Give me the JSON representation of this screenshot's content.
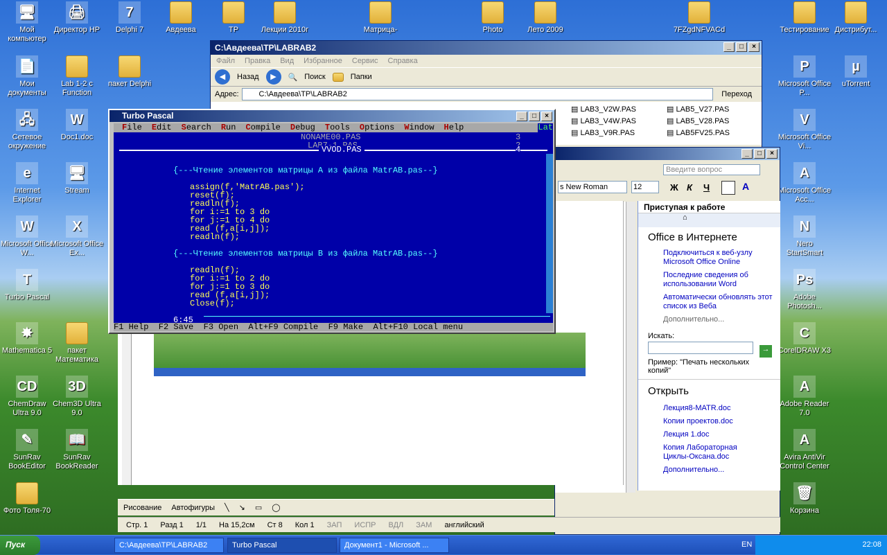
{
  "desktop_icons": [
    {
      "label": "Мой компьютер",
      "glyph": "🖥"
    },
    {
      "label": "Директор HP",
      "glyph": "🖨"
    },
    {
      "label": "Delphi 7",
      "glyph": "7"
    },
    {
      "label": "Авдеева",
      "glyph": ""
    },
    {
      "label": "TP",
      "glyph": ""
    },
    {
      "label": "Лекции 2010г",
      "glyph": ""
    },
    {
      "label": "Матрица-",
      "glyph": ""
    },
    {
      "label": "Photo",
      "glyph": ""
    },
    {
      "label": "Лето 2009",
      "glyph": ""
    },
    {
      "label": "7FZgdNFVACd",
      "glyph": ""
    },
    {
      "label": "Тестирование",
      "glyph": ""
    },
    {
      "label": "Дистрибут...",
      "glyph": ""
    },
    {
      "label": "Мои документы",
      "glyph": "📄"
    },
    {
      "label": "Lab 1-2 с Function",
      "glyph": ""
    },
    {
      "label": "пакет Delphi",
      "glyph": ""
    },
    {
      "label": "Microsoft Office P...",
      "glyph": "P"
    },
    {
      "label": "uTorrent",
      "glyph": "µ"
    },
    {
      "label": "Сетевое окружение",
      "glyph": "🖧"
    },
    {
      "label": "Doc1.doc",
      "glyph": "W"
    },
    {
      "label": "Microsoft Office Vi...",
      "glyph": "V"
    },
    {
      "label": "Internet Explorer",
      "glyph": "e"
    },
    {
      "label": "Stream",
      "glyph": "🖥"
    },
    {
      "label": "Microsoft Office Acc...",
      "glyph": "A"
    },
    {
      "label": "Microsoft Office W...",
      "glyph": "W"
    },
    {
      "label": "Microsoft Office Ex...",
      "glyph": "X"
    },
    {
      "label": "Nero StartSmart",
      "glyph": "N"
    },
    {
      "label": "Turbo Pascal",
      "glyph": "T"
    },
    {
      "label": "Adobe Photosh...",
      "glyph": "Ps"
    },
    {
      "label": "Mathematica 5",
      "glyph": "✸"
    },
    {
      "label": "пакет Математика",
      "glyph": ""
    },
    {
      "label": "CorelDRAW X3",
      "glyph": "C"
    },
    {
      "label": "ChemDraw Ultra 9.0",
      "glyph": "CD"
    },
    {
      "label": "Chem3D Ultra 9.0",
      "glyph": "3D"
    },
    {
      "label": "Adobe Reader 7.0",
      "glyph": "A"
    },
    {
      "label": "SunRav BookEditor",
      "glyph": "✎"
    },
    {
      "label": "SunRav BookReader",
      "glyph": "📖"
    },
    {
      "label": "Avira AntiVir Control Center",
      "glyph": "A"
    },
    {
      "label": "Фото Толя-70",
      "glyph": ""
    },
    {
      "label": "Корзина",
      "glyph": "🗑"
    }
  ],
  "explorer": {
    "title": "C:\\Авдеева\\TP\\LABRAB2",
    "menu": [
      "Файл",
      "Правка",
      "Вид",
      "Избранное",
      "Сервис",
      "Справка"
    ],
    "toolbar": {
      "back": "Назад",
      "search": "Поиск",
      "folders": "Папки"
    },
    "address_label": "Адрес:",
    "address_value": "C:\\Авдеева\\TP\\LABRAB2",
    "go": "Переход",
    "files": [
      "LAB3_V2W.PAS",
      "LAB5_V27.PAS",
      "LAB3_V4W.PAS",
      "LAB5_V28.PAS",
      "LAB3_V9R.PAS",
      "LAB5FV25.PAS"
    ]
  },
  "turbo": {
    "title": "Turbo Pascal",
    "menu": [
      "File",
      "Edit",
      "Search",
      "Run",
      "Compile",
      "Debug",
      "Tools",
      "Options",
      "Window",
      "Help"
    ],
    "lat": "Lat",
    "win3": "NONAME00.PAS",
    "win3n": "3",
    "win2": "LAB7-1.PAS",
    "win2n": "2",
    "win1": "VVOD.PAS",
    "win1n": "4",
    "comment1": "{---Чтение элементов матрицы A из файла MatrAB.pas--}",
    "comment2": "{---Чтение элементов матрицы B из файла MatrAB.pas--}",
    "code1": [
      "assign(f,'MatrAB.pas');",
      "reset(f);",
      "readln(f);",
      "for i:=1 to 3 do",
      "for j:=1 to 4 do",
      "read (f,a[i,j]);",
      "readln(f);"
    ],
    "code2": [
      "readln(f);",
      "for i:=1 to 2 do",
      "for j:=1 to 3 do",
      "read (f,a[i,j]);",
      "Close(f);"
    ],
    "cursor": "6:45",
    "status": "F1 Help  F2 Save  F3 Open  Alt+F9 Compile  F9 Make  Alt+F10 Local menu"
  },
  "word": {
    "help_placeholder": "Введите вопрос",
    "font": "s New Roman",
    "size": "12",
    "fmt": [
      "Ж",
      "К",
      "Ч"
    ],
    "pane_title": "Приступая к работе",
    "office_heading": "Office в Интернете",
    "office_links": [
      "Подключиться к веб-узлу Microsoft Office Online",
      "Последние сведения об использовании Word",
      "Автоматически обновлять этот список из Веба"
    ],
    "more": "Дополнительно...",
    "search_label": "Искать:",
    "example": "Пример:  \"Печать нескольких копий\"",
    "open_heading": "Открыть",
    "open_links": [
      "Лекция8-MATR.doc",
      "Копии проектов.doc",
      "Лекция 1.doc",
      "Копия  Лабораторная Циклы-Оксана.doc"
    ],
    "open_more": "Дополнительно...",
    "drawing": "Рисование",
    "autoshapes": "Автофигуры",
    "status": [
      "Стр. 1",
      "Разд 1",
      "1/1",
      "На 15,2см",
      "Ст 8",
      "Кол 1",
      "ЗАП",
      "ИСПР",
      "ВДЛ",
      "ЗАМ",
      "английский"
    ]
  },
  "taskbar": {
    "start": "Пуск",
    "tasks": [
      "C:\\Авдеева\\TP\\LABRAB2",
      "Turbo Pascal",
      "Документ1 - Microsoft ..."
    ],
    "lang": "EN",
    "clock": "22:08"
  }
}
